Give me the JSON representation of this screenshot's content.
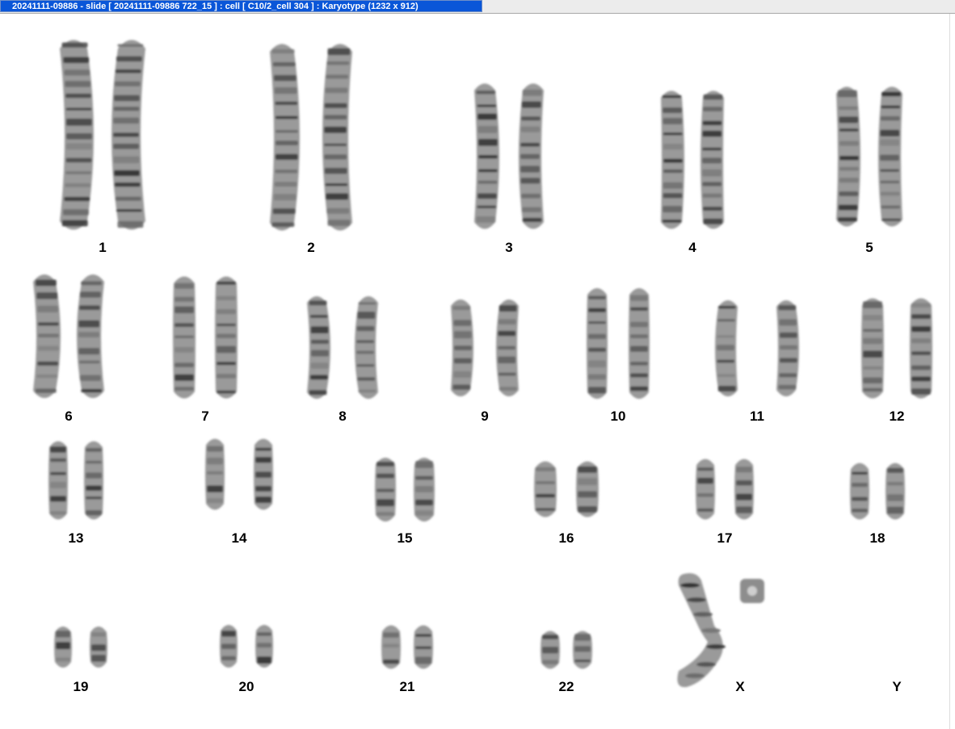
{
  "window": {
    "title": "20241111-09886 - slide [ 20241111-09886 722_15 ] : cell [ C10/2_cell 304 ] : Karyotype  (1232 x 912)"
  },
  "karyotype": {
    "labels": [
      "1",
      "2",
      "3",
      "4",
      "5",
      "6",
      "7",
      "8",
      "9",
      "10",
      "11",
      "12",
      "13",
      "14",
      "15",
      "16",
      "17",
      "18",
      "19",
      "20",
      "21",
      "22",
      "X",
      "Y"
    ]
  }
}
